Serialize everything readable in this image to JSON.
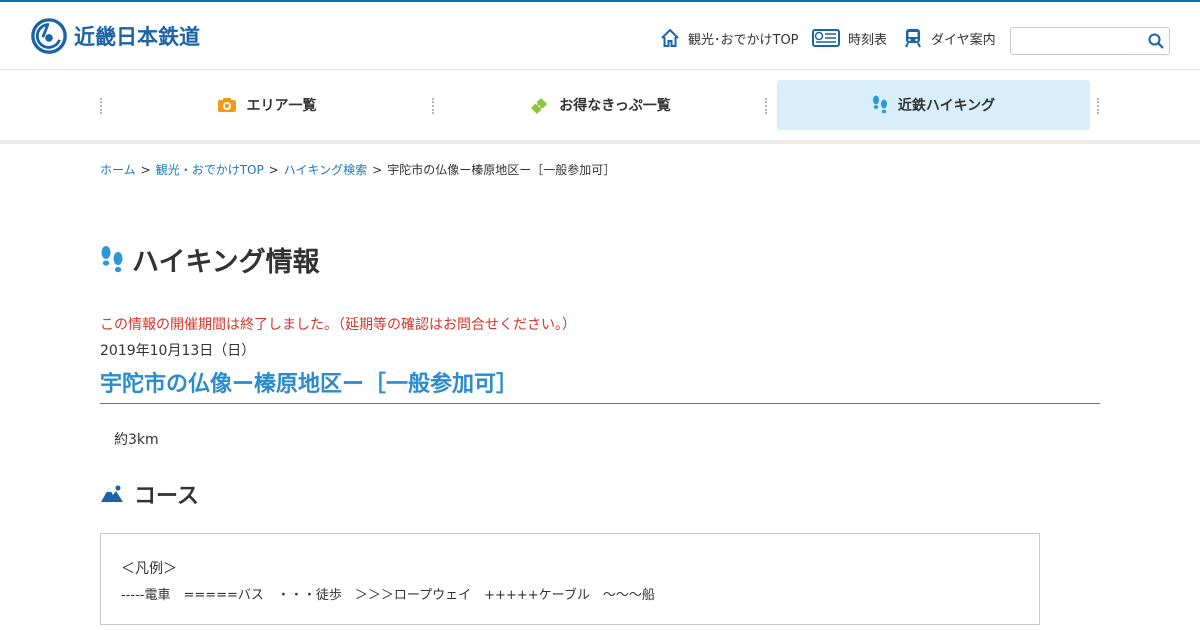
{
  "brand": {
    "name": "近畿日本鉄道",
    "accent": "#1a63a8"
  },
  "utility_links": [
    {
      "label": "観光･おでかけTOP",
      "icon": "home-icon"
    },
    {
      "label": "時刻表",
      "icon": "timetable-icon"
    },
    {
      "label": "ダイヤ案内",
      "icon": "train-icon"
    }
  ],
  "search": {
    "value": "",
    "icon": "search-icon"
  },
  "nav": [
    {
      "label": "エリア一覧",
      "icon": "camera-icon",
      "color": "#f09a17"
    },
    {
      "label": "お得なきっぷ一覧",
      "icon": "ticket-icon",
      "color": "#8cc63f"
    },
    {
      "label": "近鉄ハイキング",
      "icon": "footprints-icon",
      "color": "#2a9ad6",
      "active": true
    }
  ],
  "breadcrumb": {
    "items": [
      "ホーム",
      "観光・おでかけTOP",
      "ハイキング検索"
    ],
    "separator": ">",
    "current": "宇陀市の仏像ー榛原地区ー［一般参加可］"
  },
  "page": {
    "heading": "ハイキング情報",
    "notice": "この情報の開催期間は終了しました。（延期等の確認はお問合せください。）",
    "notice_color": "#d9342b",
    "date": "2019年10月13日（日）",
    "event_title": "宇陀市の仏像ー榛原地区ー［一般参加可］",
    "distance": "約3km",
    "course_heading": "コース",
    "legend_title": "＜凡例＞",
    "legend_line": "-----電車　=====バス　・・・徒歩　＞＞＞ロープウェイ　+++++ケーブル　〜〜〜船"
  }
}
